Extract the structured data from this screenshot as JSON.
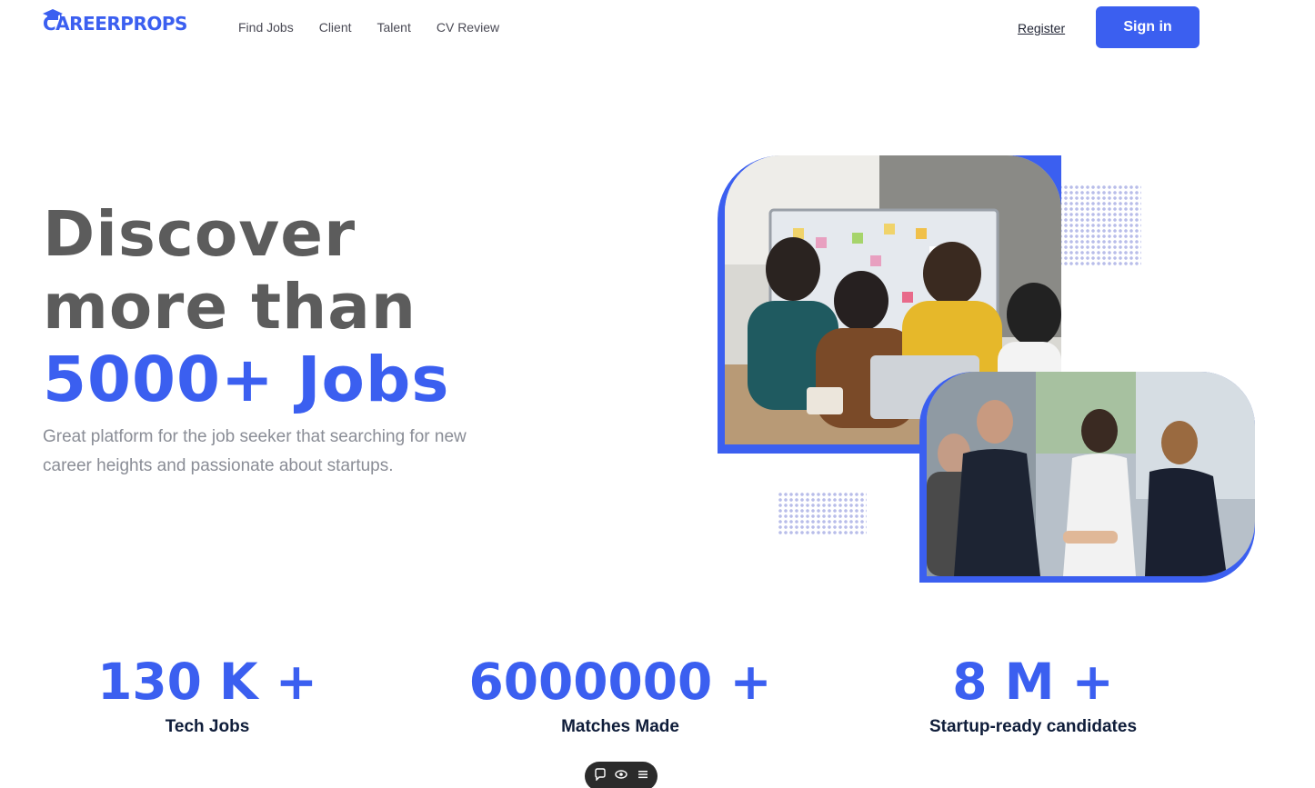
{
  "header": {
    "logo_text": "CAREERPROPS",
    "nav": [
      "Find Jobs",
      "Client",
      "Talent",
      "CV Review"
    ],
    "register_label": "Register",
    "signin_label": "Sign in"
  },
  "hero": {
    "title_line1": "Discover",
    "title_line2": "more than",
    "title_line3": "5000+ Jobs",
    "subtitle": "Great platform for the job seeker that searching for new career heights and passionate about startups."
  },
  "stats": [
    {
      "value": "130 K +",
      "label": "Tech Jobs"
    },
    {
      "value": "6000000 +",
      "label": "Matches Made"
    },
    {
      "value": "8 M +",
      "label": "Startup-ready candidates"
    }
  ],
  "colors": {
    "accent": "#3b5ff0",
    "heading": "#5c5c5c",
    "body_text": "#8a8d96",
    "stat_label": "#0f1d3a"
  },
  "icons": [
    "graduation-cap-icon",
    "chat-icon",
    "eye-icon",
    "menu-icon"
  ]
}
